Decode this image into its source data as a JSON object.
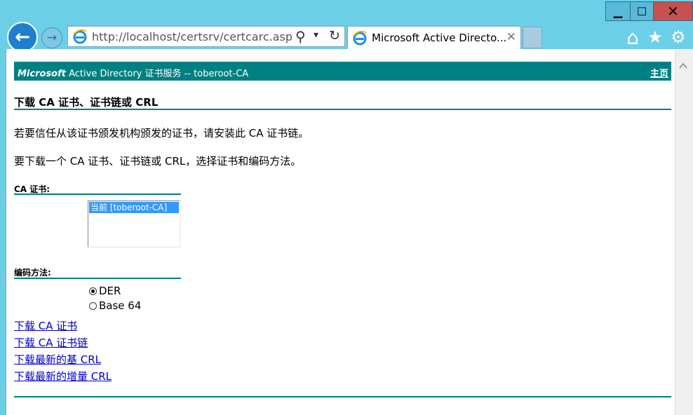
{
  "window": {
    "minimize_glyph": "▁",
    "maximize_glyph": "☐",
    "close_glyph": "✕"
  },
  "nav": {
    "back_glyph": "←",
    "forward_glyph": "→"
  },
  "address": {
    "url": "http://localhost/certsrv/certcarc.asp",
    "search_glyph": "⚲",
    "dropdown_glyph": "▾",
    "refresh_glyph": "↻"
  },
  "tab": {
    "title": "Microsoft Active Directo...",
    "close_glyph": "✕"
  },
  "toolbar": {
    "home_glyph": "⌂",
    "favorites_glyph": "★",
    "settings_glyph": "⚙"
  },
  "banner": {
    "brand": "Microsoft",
    "title": " Active Directory 证书服务  --  toberoot-CA",
    "home_link": "主页"
  },
  "page": {
    "heading": "下载 CA 证书、证书链或 CRL",
    "para1": "若要信任从该证书颁发机构颁发的证书，请安装此 CA 证书链。",
    "para2": "要下载一个 CA 证书、证书链或 CRL，选择证书和编码方法。",
    "ca_label": "CA 证书:",
    "ca_options": [
      "当前 [toberoot-CA]"
    ],
    "encoding_label": "编码方法:",
    "encoding_options": [
      {
        "label": "DER",
        "selected": true
      },
      {
        "label": "Base 64",
        "selected": false
      }
    ],
    "links": [
      "下载 CA 证书",
      "下载 CA 证书链",
      "下载最新的基 CRL",
      "下载最新的增量 CRL"
    ]
  },
  "colors": {
    "teal": "#008080",
    "link": "#0000cc",
    "selection": "#3399ff",
    "chrome": "#6ccfe8"
  }
}
